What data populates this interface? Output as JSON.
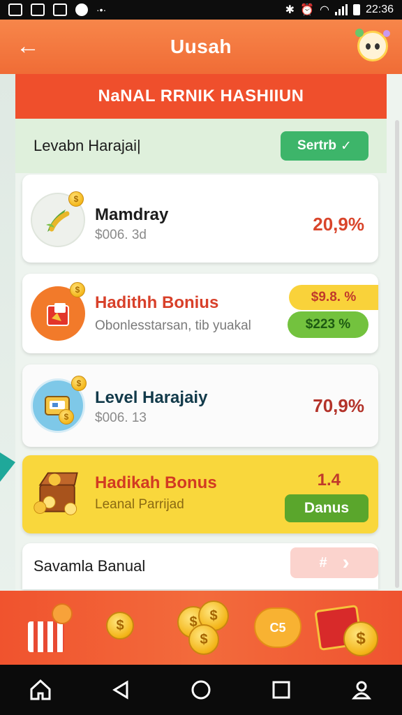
{
  "status_bar": {
    "time": "22:36"
  },
  "header": {
    "title": "Uusah",
    "back_glyph": "←"
  },
  "banner": {
    "title": "NaNAL RRNIK HASHIIUN"
  },
  "level_row": {
    "label": "Levabn Harajai|",
    "status_label": "Sertrb",
    "status_check": "✓"
  },
  "cards": [
    {
      "title": "Mamdray",
      "subtitle": "$006. 3d",
      "value": "20,9%",
      "icon": "corn-icon"
    },
    {
      "title": "Hadithh Bonius",
      "subtitle": "Obonlesstarsan, tib yuakal",
      "badge_top": "$9.8. %",
      "badge_bottom": "$223 %",
      "icon": "gift-box-icon"
    },
    {
      "title": "Level Harajaiy",
      "subtitle": "$006. 13",
      "value": "70,9%",
      "icon": "wallet-icon"
    },
    {
      "title": "Hadikah Bonus",
      "subtitle": "Leanal Parrijad",
      "value": "1.4",
      "action_label": "Danus",
      "icon": "treasure-chest-icon"
    },
    {
      "title": "Savamla Banual",
      "action_label": "#",
      "action_chevron": "›"
    }
  ],
  "rewards": {
    "heart_label": "C5",
    "coin_glyph": "$"
  },
  "colors": {
    "header": "#f06c36",
    "banner": "#ef4f2c",
    "accent_green": "#3db56a",
    "bonus_yellow": "#f9d73c"
  }
}
